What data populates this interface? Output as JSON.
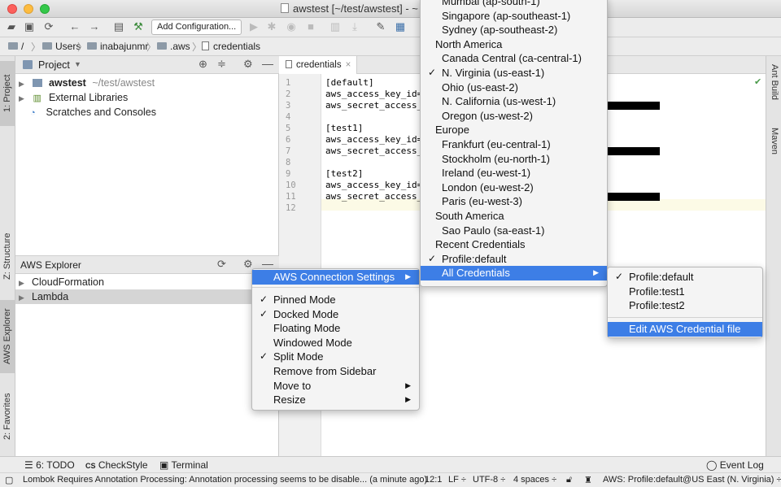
{
  "window": {
    "title": "awstest [~/test/awstest] - ~"
  },
  "toolbar": {
    "add_config_label": "Add Configuration..."
  },
  "breadcrumb": [
    "/",
    "Users",
    "inabajunmr",
    ".aws",
    "credentials"
  ],
  "left_tabs": {
    "project": "1: Project",
    "structure": "Z: Structure",
    "aws_explorer": "AWS Explorer",
    "favorites": "2: Favorites"
  },
  "right_tabs": {
    "ant": "Ant Build",
    "maven": "Maven"
  },
  "project_panel": {
    "title": "Project",
    "tree": [
      {
        "name": "awstest",
        "path": "~/test/awstest"
      },
      {
        "name": "External Libraries"
      },
      {
        "name": "Scratches and Consoles"
      }
    ]
  },
  "aws_explorer": {
    "title": "AWS Explorer",
    "items": [
      "CloudFormation",
      "Lambda"
    ]
  },
  "editor": {
    "tab": "credentials",
    "lines": [
      "[default]",
      "aws_access_key_id=",
      "aws_secret_access_",
      "",
      "[test1]",
      "aws_access_key_id=",
      "aws_secret_access_",
      "",
      "[test2]",
      "aws_access_key_id=",
      "aws_secret_access_",
      ""
    ],
    "line_numbers": [
      "1",
      "2",
      "3",
      "4",
      "5",
      "6",
      "7",
      "8",
      "9",
      "10",
      "11",
      "12"
    ]
  },
  "context_menu": {
    "items": [
      {
        "label": "AWS Connection Settings"
      },
      {
        "label": "Pinned Mode",
        "checked": true
      },
      {
        "label": "Docked Mode",
        "checked": true
      },
      {
        "label": "Floating Mode"
      },
      {
        "label": "Windowed Mode"
      },
      {
        "label": "Split Mode",
        "checked": true
      },
      {
        "label": "Remove from Sidebar"
      },
      {
        "label": "Move to"
      },
      {
        "label": "Resize"
      }
    ]
  },
  "region_menu": {
    "items": [
      {
        "label": "Mumbai (ap-south-1)"
      },
      {
        "label": "Singapore (ap-southeast-1)"
      },
      {
        "label": "Sydney (ap-southeast-2)"
      },
      {
        "label": "North America",
        "header": true
      },
      {
        "label": "Canada Central (ca-central-1)"
      },
      {
        "label": "N. Virginia (us-east-1)",
        "checked": true
      },
      {
        "label": "Ohio (us-east-2)"
      },
      {
        "label": "N. California (us-west-1)"
      },
      {
        "label": "Oregon (us-west-2)"
      },
      {
        "label": "Europe",
        "header": true
      },
      {
        "label": "Frankfurt (eu-central-1)"
      },
      {
        "label": "Stockholm (eu-north-1)"
      },
      {
        "label": "Ireland (eu-west-1)"
      },
      {
        "label": "London (eu-west-2)"
      },
      {
        "label": "Paris (eu-west-3)"
      },
      {
        "label": "South America",
        "header": true
      },
      {
        "label": "Sao Paulo (sa-east-1)"
      },
      {
        "label": "Recent Credentials",
        "header": true
      },
      {
        "label": "Profile:default",
        "checked": true
      },
      {
        "label": "All Credentials"
      }
    ]
  },
  "credentials_menu": {
    "items": [
      {
        "label": "Profile:default",
        "checked": true
      },
      {
        "label": "Profile:test1"
      },
      {
        "label": "Profile:test2"
      },
      {
        "label": "Edit AWS Credential file"
      }
    ]
  },
  "bottom_tools": {
    "todo": "6: TODO",
    "checkstyle": "CheckStyle",
    "terminal": "Terminal",
    "event_log": "Event Log"
  },
  "status": {
    "message": "Lombok Requires Annotation Processing: Annotation processing seems to be disable... (a minute ago)",
    "position": "12:1",
    "line_sep": "LF ÷",
    "encoding": "UTF-8 ÷",
    "indent": "4 spaces ÷",
    "aws": "AWS: Profile:default@US East (N. Virginia) ÷"
  },
  "colors": {
    "selection": "#3d7ee6",
    "current_line": "#fcfae6"
  }
}
